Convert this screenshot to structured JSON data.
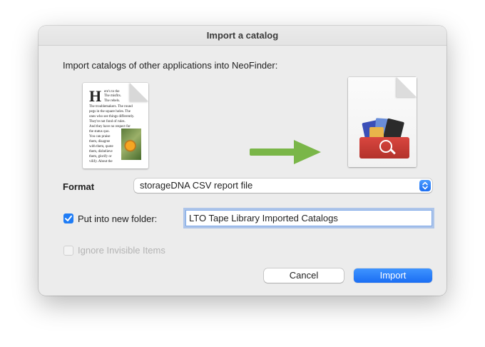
{
  "dialog": {
    "title": "Import a catalog",
    "intro": "Import catalogs of other applications into NeoFinder:"
  },
  "document_icon": {
    "dropcap": "H",
    "lines": [
      "ere's to the",
      "The misfits.",
      "The rebels.",
      "The troublemakers. The round",
      "pegs in the square holes. The",
      "ones who see things differently.",
      "They're not fond of rules.",
      "And they have no respect for",
      "the status quo.",
      "You can praise",
      "them, disagree",
      "with them, quote",
      "them, disbelieve",
      "them, glorify or",
      "vilify. About the"
    ]
  },
  "format": {
    "label": "Format",
    "selected": "storageDNA CSV report file"
  },
  "folder": {
    "checked": true,
    "label": "Put into new folder:",
    "value": "LTO Tape Library Imported Catalogs"
  },
  "invisible": {
    "label": "Ignore Invisible Items",
    "enabled": false
  },
  "buttons": {
    "cancel": "Cancel",
    "import": "Import"
  },
  "colors": {
    "accent": "#1f7cf5",
    "arrow": "#7ab648"
  },
  "icons": [
    "text-document-icon",
    "right-arrow-icon",
    "neofinder-app-icon",
    "popup-chevrons-icon",
    "checkmark-icon"
  ]
}
